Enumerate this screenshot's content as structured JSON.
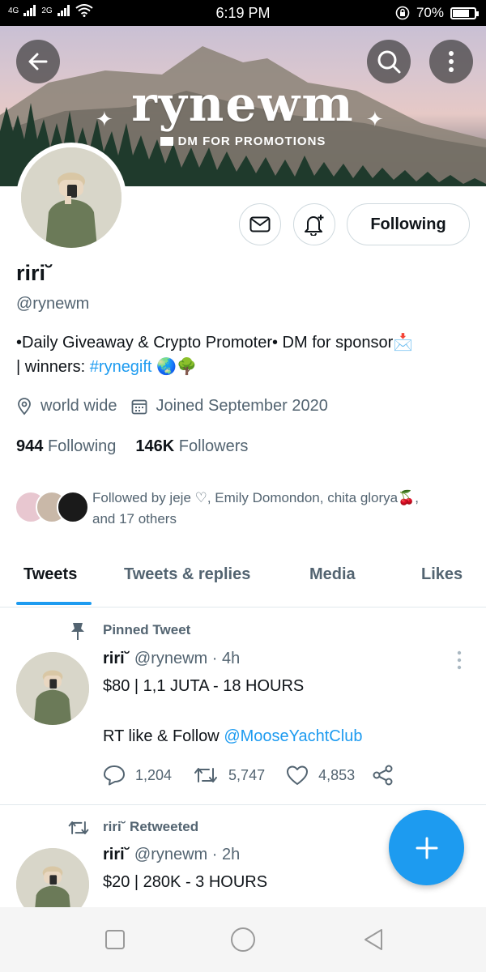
{
  "status_bar": {
    "network_left": "4G",
    "network_right": "2G",
    "time": "6:19 PM",
    "battery": "70%",
    "battery_level": 0.7
  },
  "banner": {
    "title": "rynewm",
    "subtitle": "DM FOR PROMOTIONS"
  },
  "profile": {
    "name": "riri˘",
    "handle": "@rynewm",
    "bio_line1": "•Daily Giveaway & Crypto Promoter• DM for sponsor📩",
    "bio_line2_prefix": "| winners: ",
    "bio_hashtag": "#rynegift",
    "bio_emoji": "🌏🌳",
    "location": "world wide",
    "joined": "Joined September 2020",
    "following_count": "944",
    "following_label": "Following",
    "followers_count": "146K",
    "followers_label": "Followers",
    "followed_by": "Followed by jeje ♡, Emily Domondon, chita glorya🍒,",
    "followed_by_more": "and 17 others",
    "follow_button": "Following"
  },
  "tabs": [
    {
      "label": "Tweets"
    },
    {
      "label": "Tweets & replies"
    },
    {
      "label": "Media"
    },
    {
      "label": "Likes"
    }
  ],
  "tweets": [
    {
      "pinned_label": "Pinned Tweet",
      "name": "riri˘",
      "handle": "@rynewm",
      "time": "· 4h",
      "text_line1": "$80 | 1,1 JUTA - 18 HOURS",
      "text_line2": "RT like & Follow ",
      "mention": "@MooseYachtClub",
      "replies": "1,204",
      "retweets": "5,747",
      "likes": "4,853"
    },
    {
      "retweet_label": "riri˘ Retweeted",
      "name": "riri˘",
      "handle": "@rynewm",
      "time": "· 2h",
      "text_line1": "$20 | 280K - 3 HOURS"
    }
  ],
  "colors": {
    "accent": "#1d9bf0",
    "secondary_text": "#536471",
    "border": "#cfd9de"
  }
}
